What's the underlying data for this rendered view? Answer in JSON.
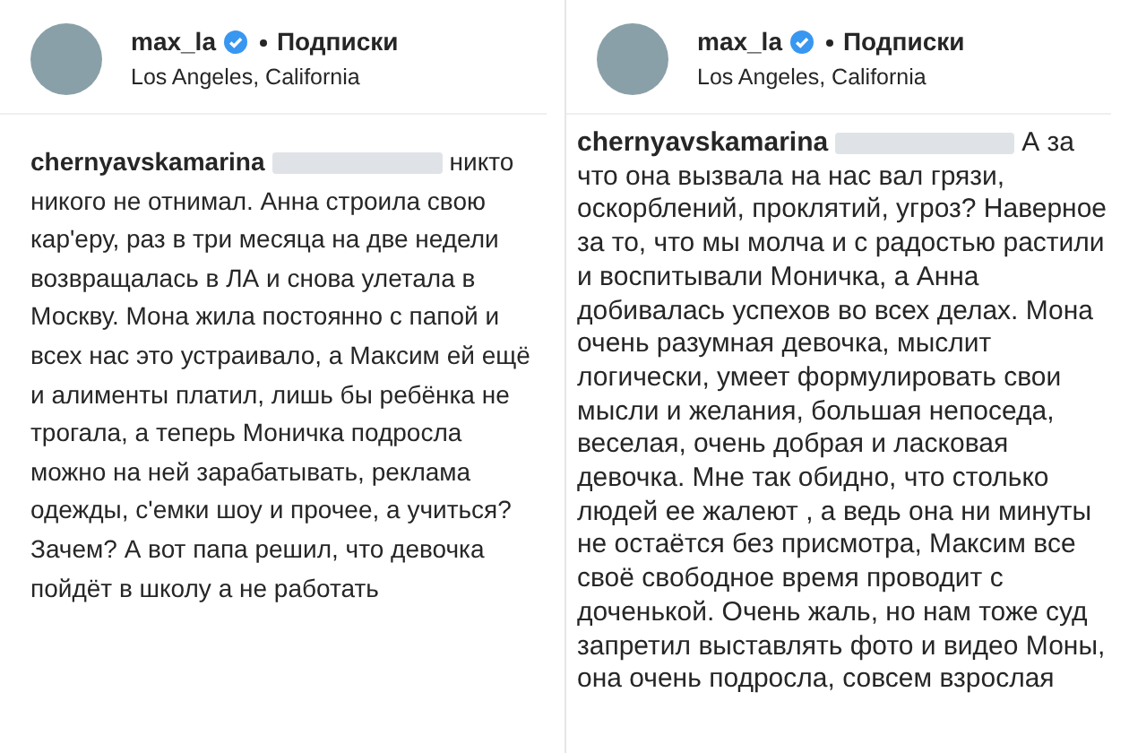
{
  "panels": [
    {
      "header": {
        "username": "max_la",
        "verified": true,
        "follow_label": "Подписки",
        "location": "Los Angeles, California"
      },
      "comment": {
        "author": "chernyavskamarina",
        "mention_blurred": true,
        "text": "никто никого не отнимал. Анна строила свою кар'еру, раз в три месяца на две недели возвращалась в ЛА и снова улетала в Москву. Мона жила постоянно с папой и всех нас это устраивало, а Максим ей ещё и алименты платил, лишь бы ребёнка не трогала, а теперь Моничка подросла можно на ней зарабатывать, реклама одежды, с'емки шоу и прочее, а учиться? Зачем? А вот папа решил, что девочка пойдёт в школу а не работать"
      }
    },
    {
      "header": {
        "username": "max_la",
        "verified": true,
        "follow_label": "Подписки",
        "location": "Los Angeles, California"
      },
      "comment": {
        "author": "chernyavskamarina",
        "mention_blurred": true,
        "text": "А за что она вызвала на нас вал грязи, оскорблений, проклятий, угроз? Наверное за то, что мы молча и с радостью растили и воспитывали Моничка, а Анна добивалась успехов во всех делах. Мона очень разумная девочка, мыслит логически, умеет формулировать свои мысли и желания, большая непоседа, веселая, очень добрая и ласковая девочка. Мне так обидно, что столько людей ее жалеют , а ведь она ни минуты не остаётся без присмотра, Максим все своё свободное время проводит с доченькой. Очень жаль, но нам тоже суд запретил выставлять фото и видео Моны, она очень подросла, совсем взрослая"
      }
    }
  ]
}
